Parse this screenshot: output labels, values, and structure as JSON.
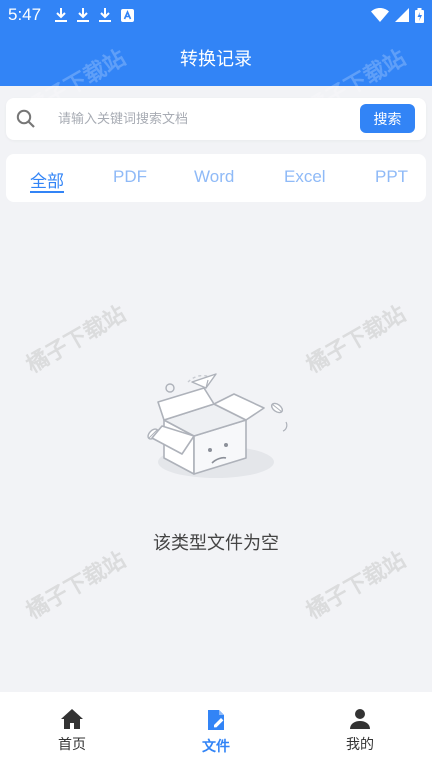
{
  "status_bar": {
    "time": "5:47",
    "notification_icons": [
      "download-icon",
      "download-icon",
      "download-icon",
      "app-notification-icon"
    ],
    "system_icons": [
      "wifi-icon",
      "signal-icon",
      "battery-icon"
    ]
  },
  "header": {
    "title": "转换记录"
  },
  "search": {
    "placeholder": "请输入关键词搜索文档",
    "value": "",
    "button_label": "搜索"
  },
  "tabs": [
    {
      "label": "全部",
      "active": true
    },
    {
      "label": "PDF",
      "active": false
    },
    {
      "label": "Word",
      "active": false
    },
    {
      "label": "Excel",
      "active": false
    },
    {
      "label": "PPT",
      "active": false
    }
  ],
  "empty_state": {
    "message": "该类型文件为空",
    "icon": "empty-box-icon"
  },
  "watermark": {
    "text": "橘子下载站"
  },
  "bottom_nav": [
    {
      "label": "首页",
      "icon": "home-icon",
      "active": false
    },
    {
      "label": "文件",
      "icon": "document-edit-icon",
      "active": true
    },
    {
      "label": "我的",
      "icon": "person-icon",
      "active": false
    }
  ],
  "colors": {
    "primary": "#3284f6",
    "inactive_tab": "#8fbaf7",
    "background": "#f2f3f6"
  }
}
